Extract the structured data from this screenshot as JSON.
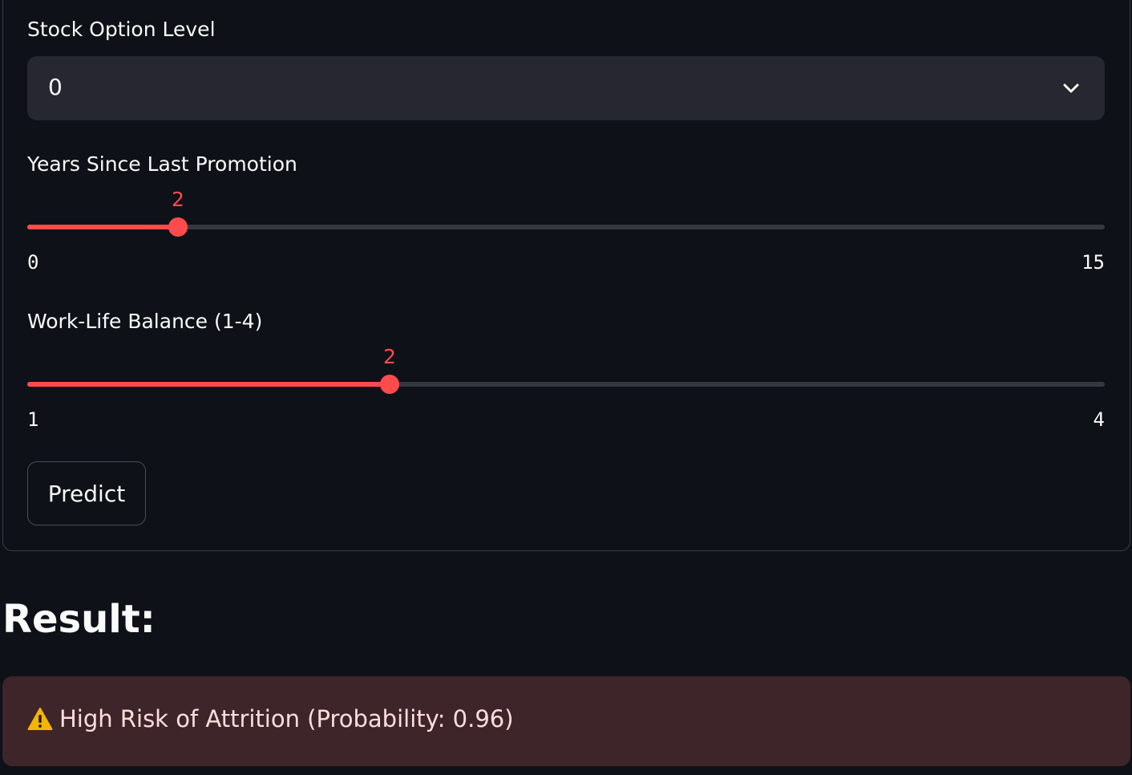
{
  "form": {
    "stock_option": {
      "label": "Stock Option Level",
      "selected_value": "0",
      "icon": "chevron-down-icon"
    },
    "promotion_slider": {
      "label": "Years Since Last Promotion",
      "value": 2,
      "value_label": "2",
      "min": 0,
      "max": 15,
      "min_label": "0",
      "max_label": "15"
    },
    "worklife_slider": {
      "label": "Work-Life Balance (1-4)",
      "value": 2,
      "value_label": "2",
      "min": 1,
      "max": 4,
      "min_label": "1",
      "max_label": "4"
    },
    "predict_label": "Predict"
  },
  "result": {
    "heading": "Result:",
    "alert_icon": "warning-icon",
    "alert_text": "High Risk of Attrition (Probability: 0.96)"
  },
  "colors": {
    "background": "#0e1117",
    "accent": "#ff4b4b",
    "select_background": "#262730",
    "alert_background": "#3d2529",
    "alert_text": "#ffdede",
    "warning_icon": "#f5b400"
  }
}
